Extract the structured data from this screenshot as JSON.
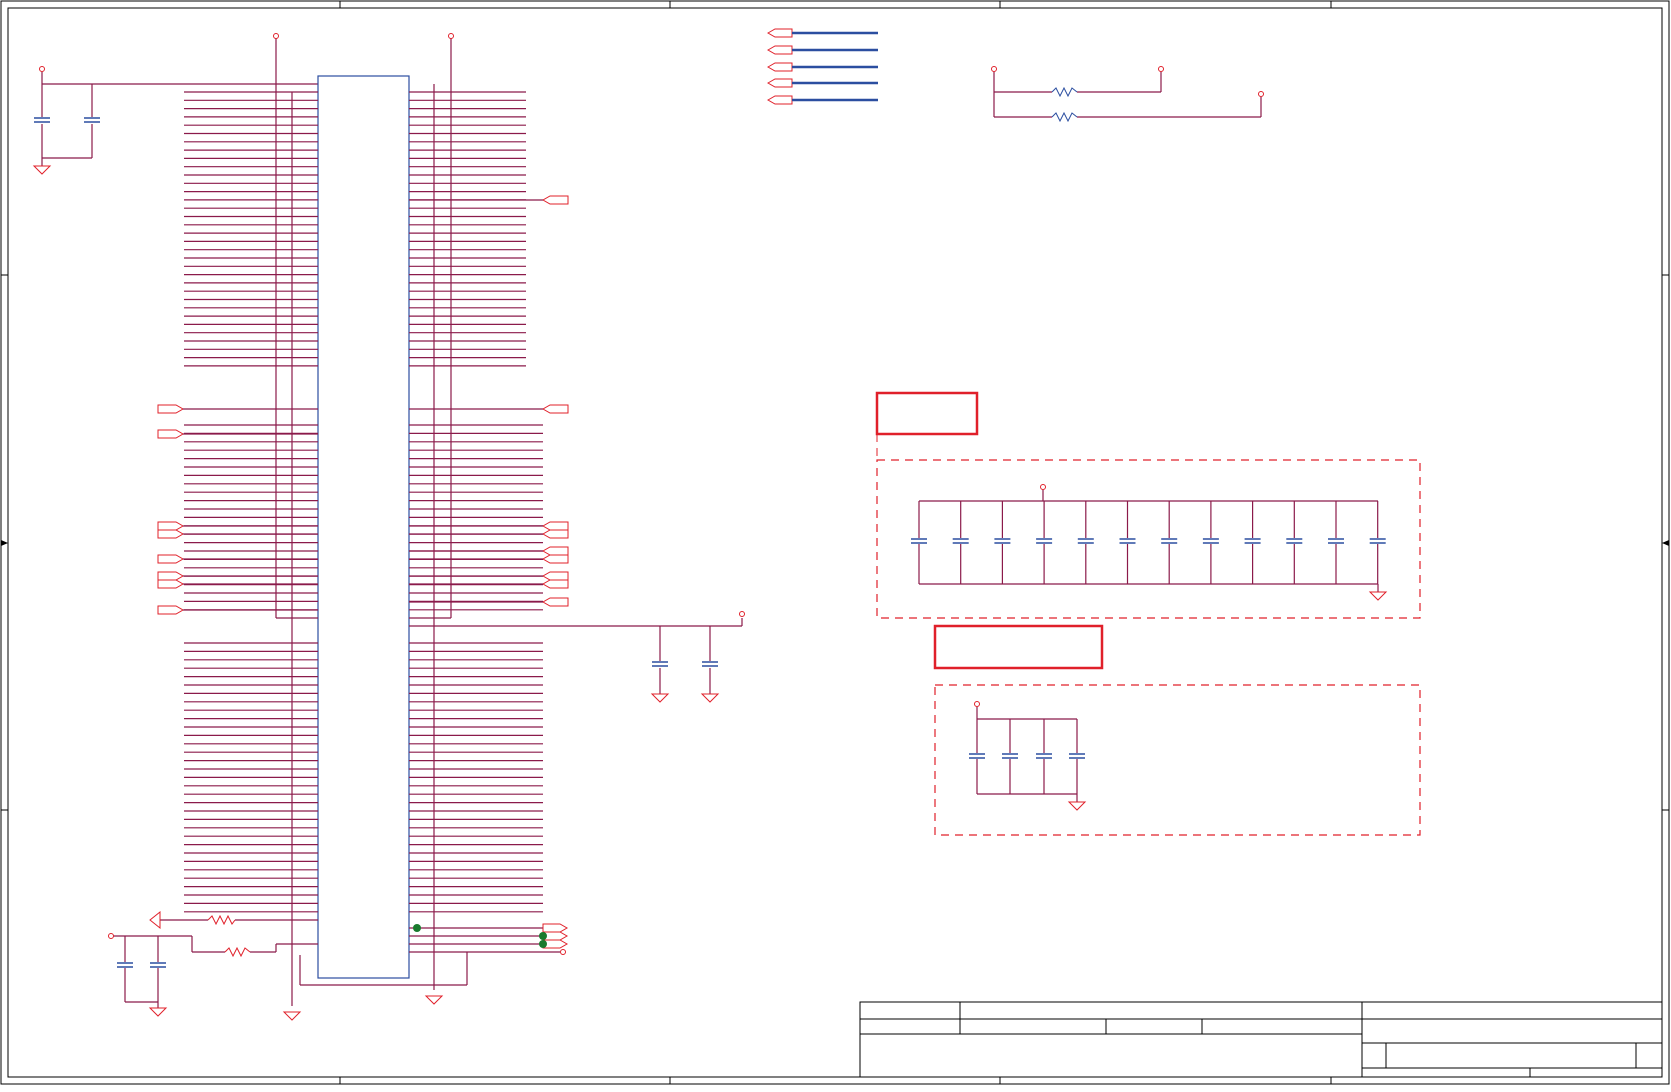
{
  "colors": {
    "wire": "#8b1a4a",
    "component": "#e0202a",
    "part_outline": "#2b4ea0",
    "bus": "#2b4ea0",
    "junction": "#1a7a2e",
    "frame": "#000000"
  },
  "schematic": {
    "description_text": "",
    "title_block": {
      "title": "",
      "size": "",
      "document_number": "",
      "revision": "",
      "date": "",
      "sheet": ""
    },
    "annotation_boxes": [
      {
        "id": "decoupling-group-1",
        "label": ""
      },
      {
        "id": "decoupling-group-2",
        "label": ""
      }
    ]
  }
}
